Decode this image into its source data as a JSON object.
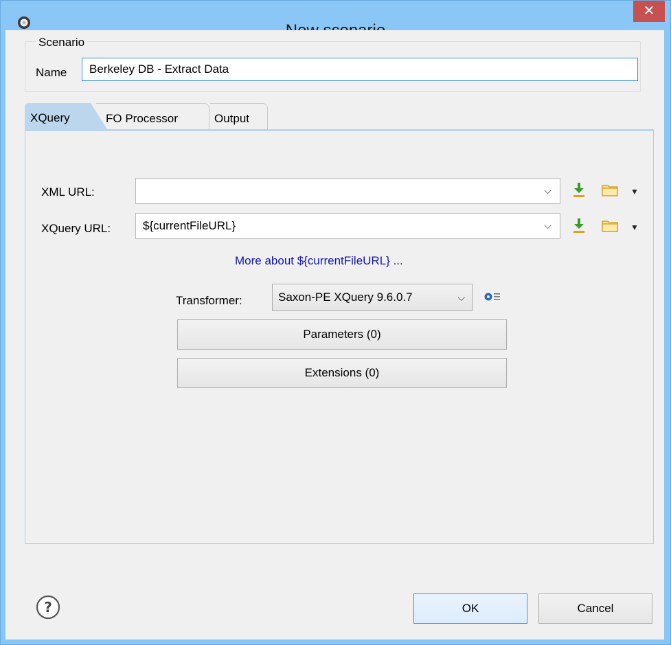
{
  "window": {
    "title": "New scenario",
    "close_label": "✕"
  },
  "scenario": {
    "group_label": "Scenario",
    "name_label": "Name",
    "name_value": "Berkeley DB - Extract Data"
  },
  "tabs": [
    {
      "label": "XQuery",
      "active": true
    },
    {
      "label": "FO Processor",
      "active": false
    },
    {
      "label": "Output",
      "active": false
    }
  ],
  "xquery_tab": {
    "xml_url_label": "XML URL:",
    "xml_url_value": "",
    "xquery_url_label": "XQuery URL:",
    "xquery_url_value": "${currentFileURL}",
    "more_link": "More about ${currentFileURL} ...",
    "transformer_label": "Transformer:",
    "transformer_value": "Saxon-PE XQuery 9.6.0.7",
    "parameters_button": "Parameters (0)",
    "extensions_button": "Extensions (0)"
  },
  "footer": {
    "ok_button": "OK",
    "cancel_button": "Cancel"
  },
  "icons": {
    "download": "download-icon",
    "folder": "folder-icon",
    "gear": "gear-icon",
    "help": "help-icon"
  },
  "colors": {
    "titlebar": "#8ac7f7",
    "close_button": "#c75050",
    "link": "#1515b0",
    "active_tab": "#bcd6ee"
  }
}
